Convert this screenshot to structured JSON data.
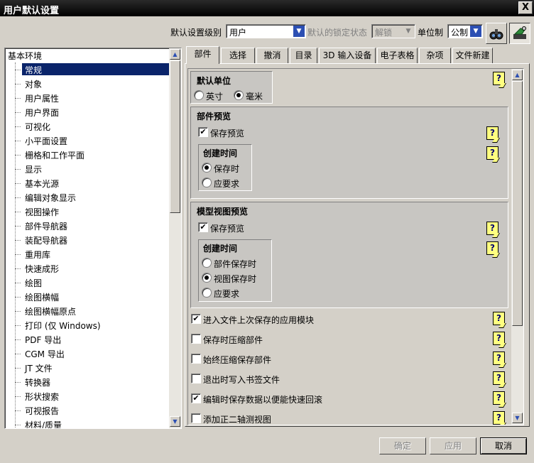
{
  "window": {
    "title": "用户默认设置",
    "close_glyph": "X"
  },
  "toolbar": {
    "level_label": "默认设置级别",
    "level_value": "用户",
    "lock_label": "默认的锁定状态",
    "lock_value": "解锁",
    "unit_label": "单位制",
    "unit_value": "公制",
    "icons": [
      "find-icon",
      "manager-icon"
    ]
  },
  "tree": {
    "root": "基本环境",
    "selected": "常规",
    "items": [
      "常规",
      "对象",
      "用户属性",
      "用户界面",
      "可视化",
      "小平面设置",
      "栅格和工作平面",
      "显示",
      "基本光源",
      "编辑对象显示",
      "视图操作",
      "部件导航器",
      "装配导航器",
      "重用库",
      "快速成形",
      "绘图",
      "绘图横幅",
      "绘图横幅原点",
      "打印 (仅 Windows)",
      "PDF 导出",
      "CGM 导出",
      "JT 文件",
      "转换器",
      "形状搜索",
      "可视报告",
      "材料/质量"
    ]
  },
  "tabs": [
    "部件",
    "选择",
    "撤消",
    "目录",
    "3D 输入设备",
    "电子表格",
    "杂项",
    "文件新建"
  ],
  "active_tab": "部件",
  "panel": {
    "default_unit": {
      "title": "默认单位",
      "opt_inch": "英寸",
      "opt_mm": "毫米",
      "selected": "毫米"
    },
    "part_preview": {
      "title": "部件预览",
      "save_preview": "保存预览",
      "save_preview_checked": true,
      "create_time": {
        "title": "创建时间",
        "opt_on_save": "保存时",
        "opt_on_demand": "应要求",
        "selected": "保存时"
      }
    },
    "model_view_preview": {
      "title": "模型视图预览",
      "save_preview": "保存预览",
      "save_preview_checked": true,
      "create_time": {
        "title": "创建时间",
        "opt_part_save": "部件保存时",
        "opt_view_save": "视图保存时",
        "opt_on_demand": "应要求",
        "selected": "视图保存时"
      }
    },
    "options": [
      {
        "label": "进入文件上次保存的应用模块",
        "checked": true
      },
      {
        "label": "保存时压缩部件",
        "checked": false
      },
      {
        "label": "始终压缩保存部件",
        "checked": false
      },
      {
        "label": "退出时写入书签文件",
        "checked": false
      },
      {
        "label": "编辑时保存数据以便能快速回滚",
        "checked": true
      },
      {
        "label": "添加正二轴测视图",
        "checked": false
      }
    ]
  },
  "help_glyph": "?",
  "buttons": {
    "ok": "确定",
    "apply": "应用",
    "cancel": "取消"
  },
  "colors": {
    "title_bg": "#000000",
    "selection": "#0a246a",
    "help_bg": "#ffff80",
    "dialog_bg": "#d4d0c8"
  }
}
